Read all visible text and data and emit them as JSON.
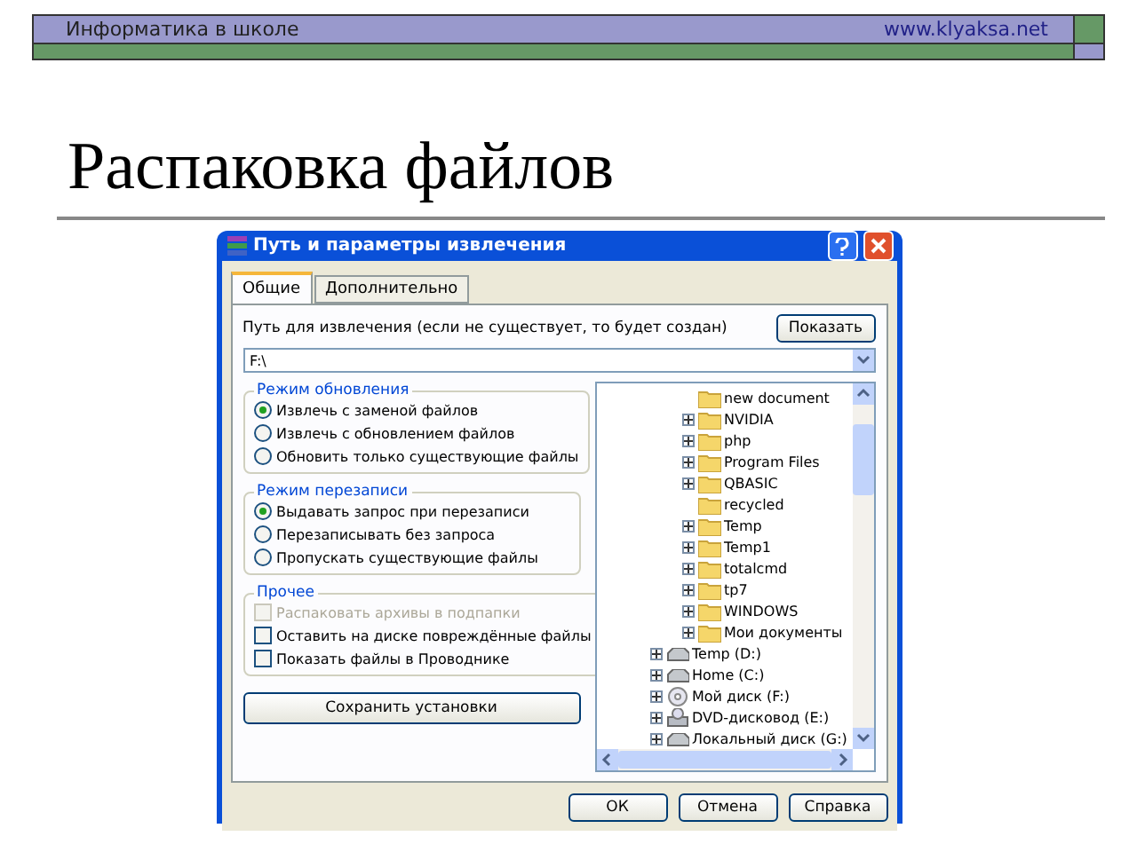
{
  "header": {
    "left": "Информатика в школе",
    "right": "www.klyaksa.net"
  },
  "slide_title": "Распаковка файлов",
  "dialog": {
    "title": "Путь и параметры извлечения",
    "tabs": [
      {
        "label": "Общие",
        "selected": true
      },
      {
        "label": "Дополнительно",
        "selected": false
      }
    ],
    "path_label": "Путь для извлечения (если не существует, то будет создан)",
    "show_button": "Показать",
    "path_value": "F:\\",
    "groups": [
      {
        "title": "Режим обновления",
        "options": [
          {
            "kind": "radio",
            "label": "Извлечь с заменой файлов",
            "checked": true,
            "disabled": false
          },
          {
            "kind": "radio",
            "label": "Извлечь с обновлением файлов",
            "checked": false,
            "disabled": false
          },
          {
            "kind": "radio",
            "label": "Обновить только существующие файлы",
            "checked": false,
            "disabled": false
          }
        ]
      },
      {
        "title": "Режим перезаписи",
        "options": [
          {
            "kind": "radio",
            "label": "Выдавать запрос при перезаписи",
            "checked": true,
            "disabled": false
          },
          {
            "kind": "radio",
            "label": "Перезаписывать без запроса",
            "checked": false,
            "disabled": false
          },
          {
            "kind": "radio",
            "label": "Пропускать существующие файлы",
            "checked": false,
            "disabled": false
          }
        ]
      },
      {
        "title": "Прочее",
        "options": [
          {
            "kind": "checkbox",
            "label": "Распаковать архивы в подпапки",
            "checked": false,
            "disabled": true
          },
          {
            "kind": "checkbox",
            "label": "Оставить на диске повреждённые файлы",
            "checked": false,
            "disabled": false
          },
          {
            "kind": "checkbox",
            "label": "Показать файлы в Проводнике",
            "checked": false,
            "disabled": false
          }
        ]
      }
    ],
    "save_button": "Сохранить установки",
    "tree": {
      "folders": [
        {
          "label": "new document",
          "expandable": false
        },
        {
          "label": "NVIDIA",
          "expandable": true
        },
        {
          "label": "php",
          "expandable": true
        },
        {
          "label": "Program Files",
          "expandable": true
        },
        {
          "label": "QBASIC",
          "expandable": true
        },
        {
          "label": "recycled",
          "expandable": false
        },
        {
          "label": "Temp",
          "expandable": true
        },
        {
          "label": "Temp1",
          "expandable": true
        },
        {
          "label": "totalcmd",
          "expandable": true
        },
        {
          "label": "tp7",
          "expandable": true
        },
        {
          "label": "WINDOWS",
          "expandable": true
        },
        {
          "label": "Мои документы",
          "expandable": true
        }
      ],
      "drives": [
        {
          "kind": "disk",
          "label": "Temp (D:)"
        },
        {
          "kind": "disk",
          "label": "Home (C:)"
        },
        {
          "kind": "cd",
          "label": "Мой диск (F:)"
        },
        {
          "kind": "dvd",
          "label": "DVD-дисковод (E:)"
        },
        {
          "kind": "disk",
          "label": "Локальный диск (G:)"
        }
      ]
    },
    "buttons": [
      "ОК",
      "Отмена",
      "Справка"
    ]
  }
}
